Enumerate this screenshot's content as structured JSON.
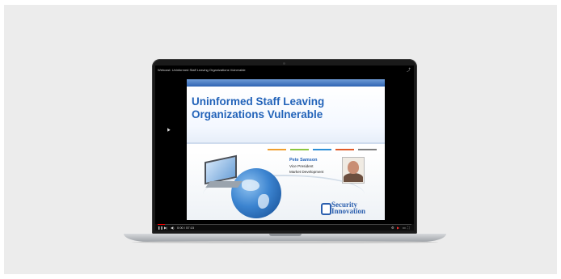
{
  "video": {
    "title": "Webcast: Uninformed Staff Leaving Organizations Vulnerable",
    "menu_icon": "share-icon",
    "progress": 0.03
  },
  "slide": {
    "title_line1": "Uninformed Staff Leaving",
    "title_line2": "Organizations Vulnerable",
    "speaker_name": "Pete Samson",
    "speaker_role_line1": "Vice President",
    "speaker_role_line2": "Market Development",
    "logo_line1": "Security",
    "logo_line2": "Innovation",
    "accent_colors": [
      "#f0a030",
      "#8cc63f",
      "#2c8fd6",
      "#e05a28",
      "#7f7f7f"
    ]
  },
  "player_controls": {
    "play_icon": "pause-icon",
    "next_icon": "next-icon",
    "volume_icon": "volume-icon",
    "time": "0:00 / 57:15",
    "right_icons": [
      "settings-icon",
      "youtube-icon",
      "theater-icon",
      "fullscreen-icon"
    ]
  },
  "colors": {
    "title_blue": "#2263b9",
    "progress_red": "#ff0000"
  }
}
